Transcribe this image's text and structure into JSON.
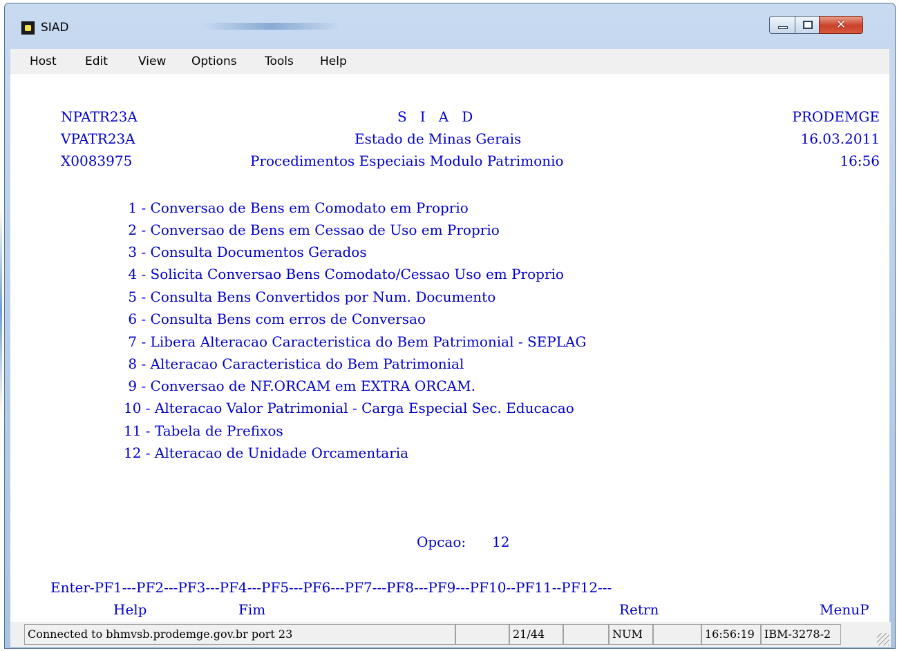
{
  "window": {
    "title": "SIAD"
  },
  "menu": [
    "Host",
    "Edit",
    "View",
    "Options",
    "Tools",
    "Help"
  ],
  "header": {
    "left": [
      "NPATR23A",
      "VPATR23A",
      "X0083975"
    ],
    "center": [
      "S   I   A   D",
      "Estado de Minas Gerais",
      "Procedimentos Especiais Modulo Patrimonio"
    ],
    "right": [
      "PRODEMGE",
      "16.03.2011",
      "16:56"
    ]
  },
  "options": [
    " 1 - Conversao de Bens em Comodato em Proprio",
    " 2 - Conversao de Bens em Cessao de Uso em Proprio",
    " 3 - Consulta Documentos Gerados",
    " 4 - Solicita Conversao Bens Comodato/Cessao Uso em Proprio",
    " 5 - Consulta Bens Convertidos por Num. Documento",
    " 6 - Consulta Bens com erros de Conversao",
    " 7 - Libera Alteracao Caracteristica do Bem Patrimonial - SEPLAG",
    " 8 - Alteracao Caracteristica do Bem Patrimonial",
    " 9 - Conversao de NF.ORCAM em EXTRA ORCAM.",
    "10 - Alteracao Valor Patrimonial - Carga Especial Sec. Educacao",
    "11 - Tabela de Prefixos",
    "12 - Alteracao de Unidade Orcamentaria"
  ],
  "prompt": {
    "label": "Opcao:",
    "value": "12"
  },
  "function_keys": {
    "line": "Enter-PF1---PF2---PF3---PF4---PF5---PF6---PF7---PF8---PF9---PF10--PF11--PF12---",
    "labels": {
      "help": "Help",
      "fim": "Fim",
      "retrn": "Retrn",
      "menup": "MenuP"
    }
  },
  "status": {
    "connection": "Connected to bhmvsb.prodemge.gov.br port 23",
    "cursor": "21/44",
    "num": "NUM",
    "time": "16:56:19",
    "terminal": "IBM-3278-2"
  },
  "colors": {
    "terminal_text": "#0000c8",
    "terminal_bg": "#ffffff"
  }
}
